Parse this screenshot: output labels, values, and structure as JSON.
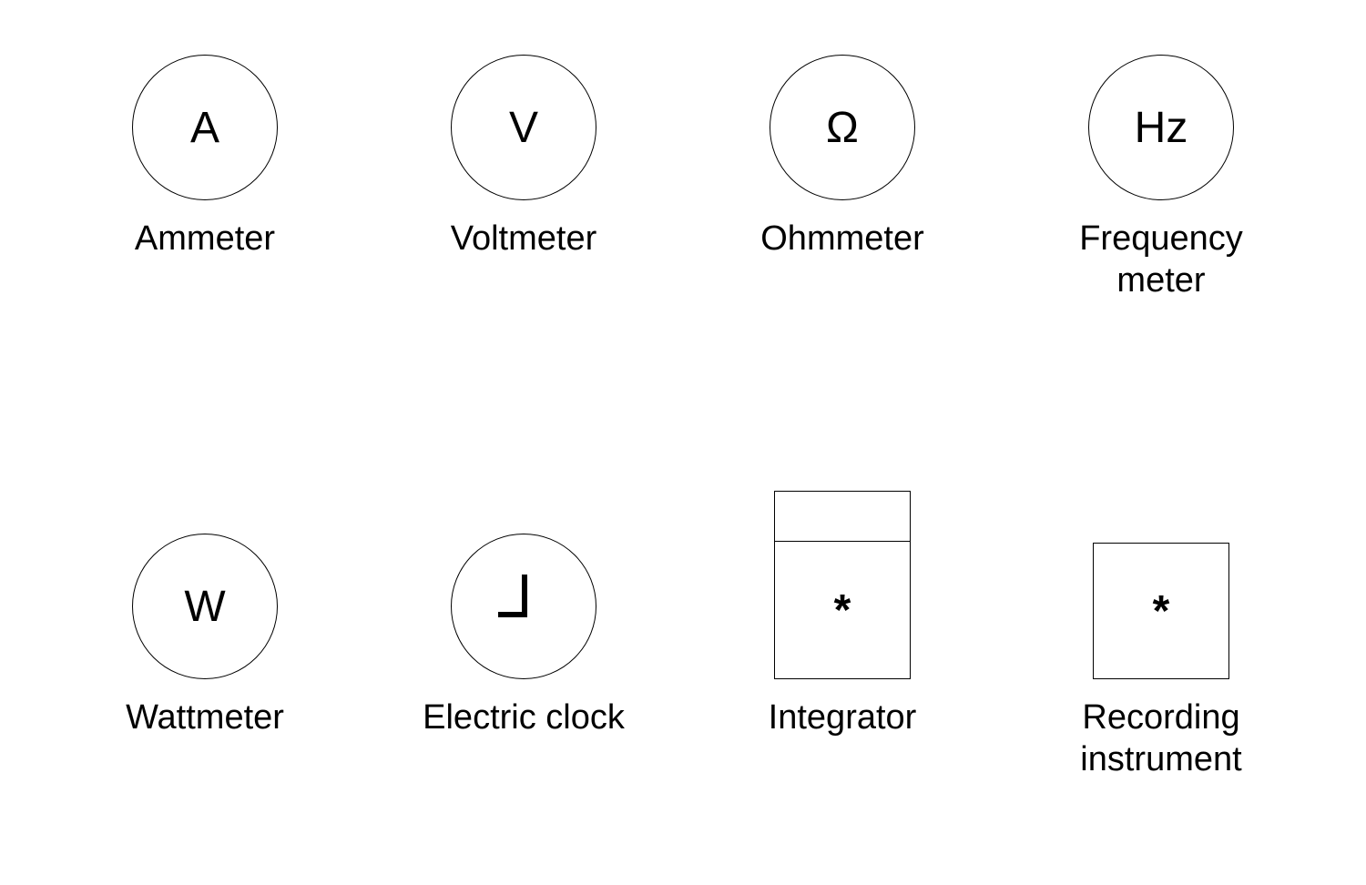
{
  "instruments": [
    {
      "label": "Ammeter",
      "symbol": "A",
      "shape": "circle"
    },
    {
      "label": "Voltmeter",
      "symbol": "V",
      "shape": "circle"
    },
    {
      "label": "Ohmmeter",
      "symbol": "Ω",
      "shape": "circle"
    },
    {
      "label": "Frequency meter",
      "symbol": "Hz",
      "shape": "circle"
    },
    {
      "label": "Wattmeter",
      "symbol": "W",
      "shape": "circle"
    },
    {
      "label": "Electric clock",
      "symbol": "clock-hands",
      "shape": "circle"
    },
    {
      "label": "Integrator",
      "symbol": "*",
      "shape": "integrator"
    },
    {
      "label": "Recording instrument",
      "symbol": "*",
      "shape": "recorder"
    }
  ]
}
